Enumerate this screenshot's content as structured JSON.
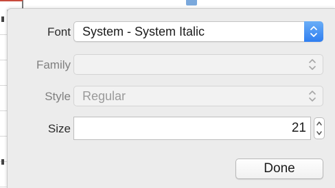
{
  "font_panel": {
    "font": {
      "label": "Font",
      "value": "System - System Italic",
      "enabled": true
    },
    "family": {
      "label": "Family",
      "value": "",
      "enabled": false
    },
    "style": {
      "label": "Style",
      "value": "Regular",
      "enabled": false
    },
    "size": {
      "label": "Size",
      "value": "21"
    },
    "done_label": "Done"
  },
  "colors": {
    "accent": "#2f7ef0",
    "panel_bg": "#ececec",
    "disabled_text": "#9a9a9a"
  }
}
